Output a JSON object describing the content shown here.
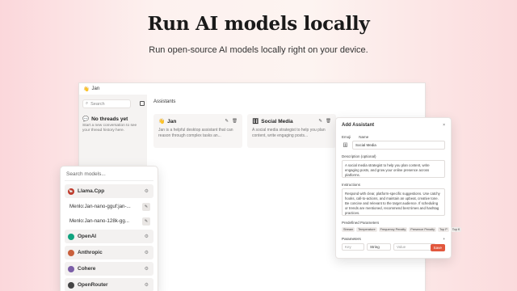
{
  "hero": {
    "title": "Run AI models locally",
    "subtitle": "Run open-source AI models locally right on your device."
  },
  "window": {
    "title": "Jan"
  },
  "sidebar": {
    "search_placeholder": "Search",
    "empty_title": "No threads yet",
    "empty_desc": "Start a new conversation to see your thread history here."
  },
  "main": {
    "heading": "Assistants",
    "cards": [
      {
        "emoji": "👋",
        "name": "Jan",
        "desc": "Jan is a helpful desktop assistant that can reason through complex tasks an..."
      },
      {
        "emoji": "🗄",
        "name": "Social Media",
        "desc": "A social media strategist to help you plan content, write engaging posts..."
      }
    ]
  },
  "dialog": {
    "title": "Add Assistant",
    "close": "×",
    "emoji_label": "Emoji",
    "name_label": "Name",
    "emoji": "🗄",
    "name_value": "Social Media",
    "desc_label": "Description (optional)",
    "desc_value": "A social media strategist to help you plan content, write engaging posts, and grow your online presence across platforms.",
    "instr_label": "Instructions",
    "instr_value": "Respond with clear, platform-specific suggestions. Use catchy hooks, call-to-actions, and maintain an upbeat, creative tone. Be concise and relevant to the target audience. If scheduling or trends are mentioned, recommend best times and hashtag practices.",
    "predef_label": "Predefined Parameters",
    "chips": [
      "Stream",
      "Temperature",
      "Frequency Penalty",
      "Presence Penalty",
      "Top P",
      "Top K"
    ],
    "params_label": "Parameters",
    "param_key_ph": "Key",
    "param_type": "String",
    "param_value_ph": "Value",
    "save": "Save"
  },
  "models": {
    "search_placeholder": "Search models...",
    "providers": [
      {
        "name": "Llama.Cpp",
        "color": "#c0392b",
        "models": [
          "Menlo:Jan-nano-gguf:jan-...",
          "Menlo:Jan-nano-128k-gg..."
        ]
      },
      {
        "name": "OpenAI",
        "color": "#10a37f",
        "models": []
      },
      {
        "name": "Anthropic",
        "color": "#c9603c",
        "models": []
      },
      {
        "name": "Cohere",
        "color": "#7b5ea7",
        "models": []
      },
      {
        "name": "OpenRouter",
        "color": "#444444",
        "models": []
      }
    ]
  }
}
